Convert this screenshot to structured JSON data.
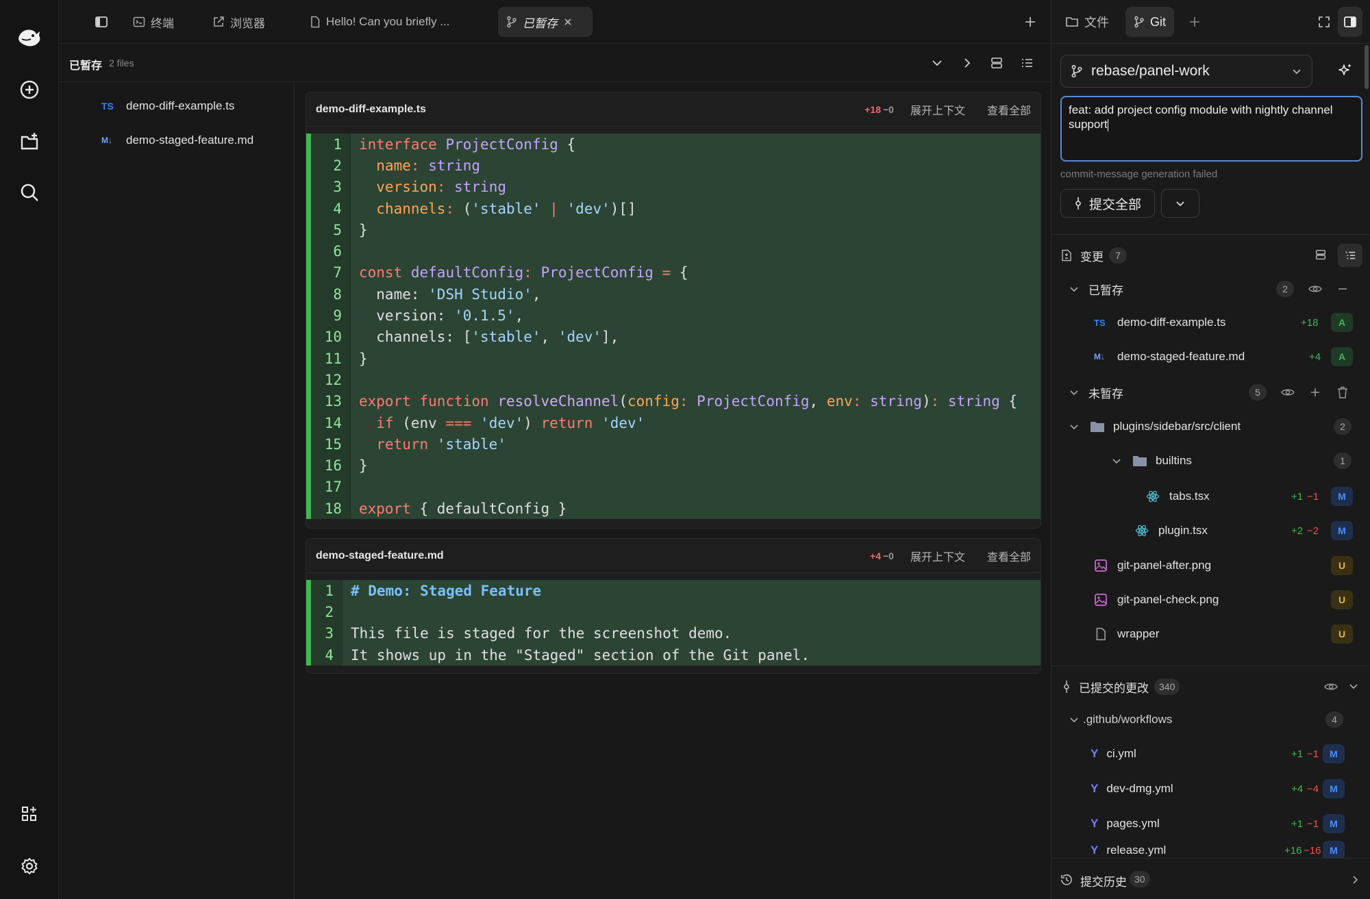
{
  "tabs": {
    "terminal": "终端",
    "browser": "浏览器",
    "chat": "Hello! Can you briefly ...",
    "staged": "已暂存"
  },
  "subbar": {
    "title": "已暂存",
    "count": "2 files"
  },
  "file_list": [
    {
      "badge": "TS",
      "name": "demo-diff-example.ts"
    },
    {
      "badge": "M↓",
      "name": "demo-staged-feature.md"
    }
  ],
  "diffs": [
    {
      "file": "demo-diff-example.ts",
      "add": "+18",
      "del": "−0",
      "expand": "展开上下文",
      "view_all": "查看全部"
    },
    {
      "file": "demo-staged-feature.md",
      "add": "+4",
      "del": "−0",
      "expand": "展开上下文",
      "view_all": "查看全部"
    }
  ],
  "right": {
    "tab_files": "文件",
    "tab_git": "Git",
    "branch": "rebase/panel-work",
    "commit_message": "feat: add project config module with nightly channel support",
    "gen_status": "commit-message generation failed",
    "commit_button": "提交全部",
    "changes": {
      "label": "变更",
      "count": "7"
    },
    "staged": {
      "label": "已暂存",
      "count": "2",
      "items": [
        {
          "badge": "TS",
          "name": "demo-diff-example.ts",
          "add": "+18",
          "status": "A"
        },
        {
          "badge": "M↓",
          "name": "demo-staged-feature.md",
          "add": "+4",
          "status": "A"
        }
      ]
    },
    "unstaged": {
      "label": "未暂存",
      "count": "5",
      "folder": {
        "name": "plugins/sidebar/src/client",
        "count": "2"
      },
      "subfolder": {
        "name": "builtins",
        "count": "1"
      },
      "files": [
        {
          "name": "tabs.tsx",
          "add": "+1",
          "del": "−1",
          "status": "M"
        },
        {
          "name": "plugin.tsx",
          "add": "+2",
          "del": "−2",
          "status": "M"
        },
        {
          "name": "git-panel-after.png",
          "status": "U"
        },
        {
          "name": "git-panel-check.png",
          "status": "U"
        },
        {
          "name": "wrapper",
          "status": "U"
        }
      ]
    },
    "committed": {
      "label": "已提交的更改",
      "count": "340",
      "folder": {
        "name": ".github/workflows",
        "count": "4"
      },
      "files": [
        {
          "name": "ci.yml",
          "add": "+1",
          "del": "−1",
          "status": "M"
        },
        {
          "name": "dev-dmg.yml",
          "add": "+4",
          "del": "−4",
          "status": "M"
        },
        {
          "name": "pages.yml",
          "add": "+1",
          "del": "−1",
          "status": "M"
        },
        {
          "name": "release.yml",
          "add": "+16",
          "del": "−16",
          "status": "M"
        }
      ]
    },
    "history": {
      "label": "提交历史",
      "count": "30"
    }
  },
  "colors": {
    "accent": "#5b8bd6",
    "added": "#3fb950",
    "deleted": "#f85149",
    "modified": "#4c8df6",
    "untracked": "#e3b341"
  }
}
